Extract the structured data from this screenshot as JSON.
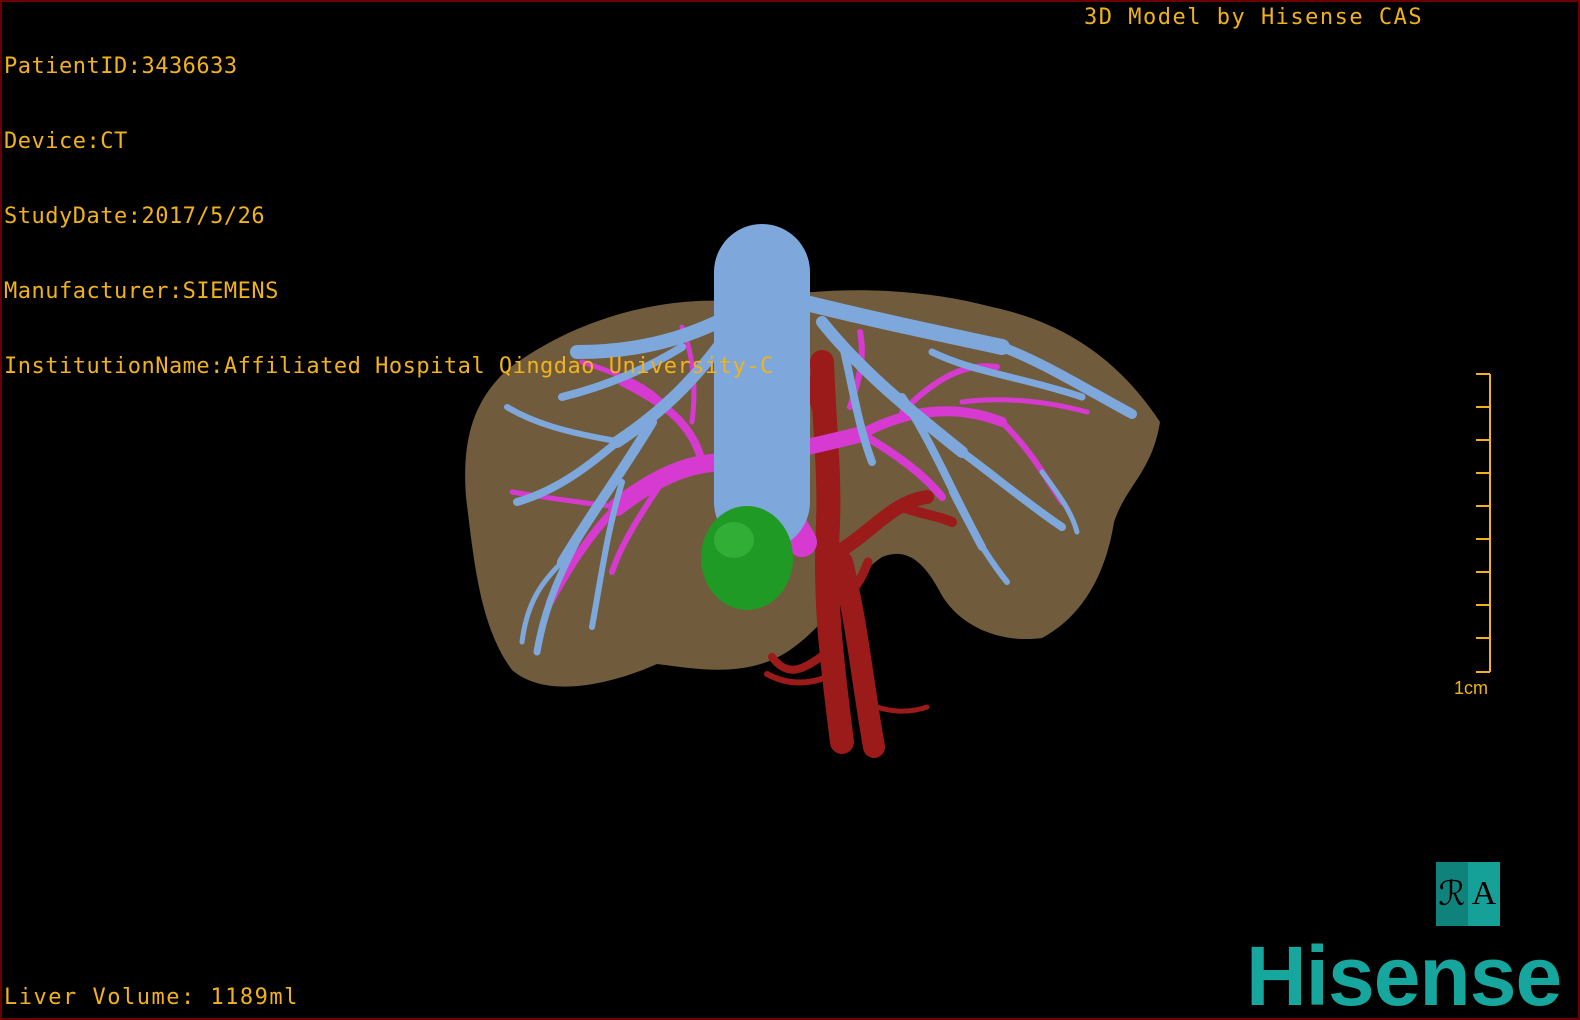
{
  "overlay": {
    "patient_id": "PatientID:3436633",
    "device": "Device:CT",
    "study_date": "StudyDate:2017/5/26",
    "manufacturer": "Manufacturer:SIEMENS",
    "institution": "InstitutionName:Affiliated Hospital Qingdao University-C",
    "credit": "3D Model by Hisense CAS",
    "liver_volume": "Liver Volume: 1189ml"
  },
  "scale": {
    "label": "1cm"
  },
  "orientation": {
    "left_glyph": "ℛ",
    "right_glyph": "A"
  },
  "brand": {
    "logo_text": "Hisense"
  },
  "colors": {
    "text": "#f2b21c",
    "liver": "#7a6442",
    "hepatic_vein": "#7ea8dc",
    "portal_vein": "#d63ad0",
    "artery": "#9b1a1a",
    "tumor": "#1f9a24",
    "brand": "#17a69e",
    "border": "#6b0000"
  },
  "structures": [
    "liver",
    "hepatic-vein",
    "portal-vein",
    "hepatic-artery",
    "tumor"
  ]
}
